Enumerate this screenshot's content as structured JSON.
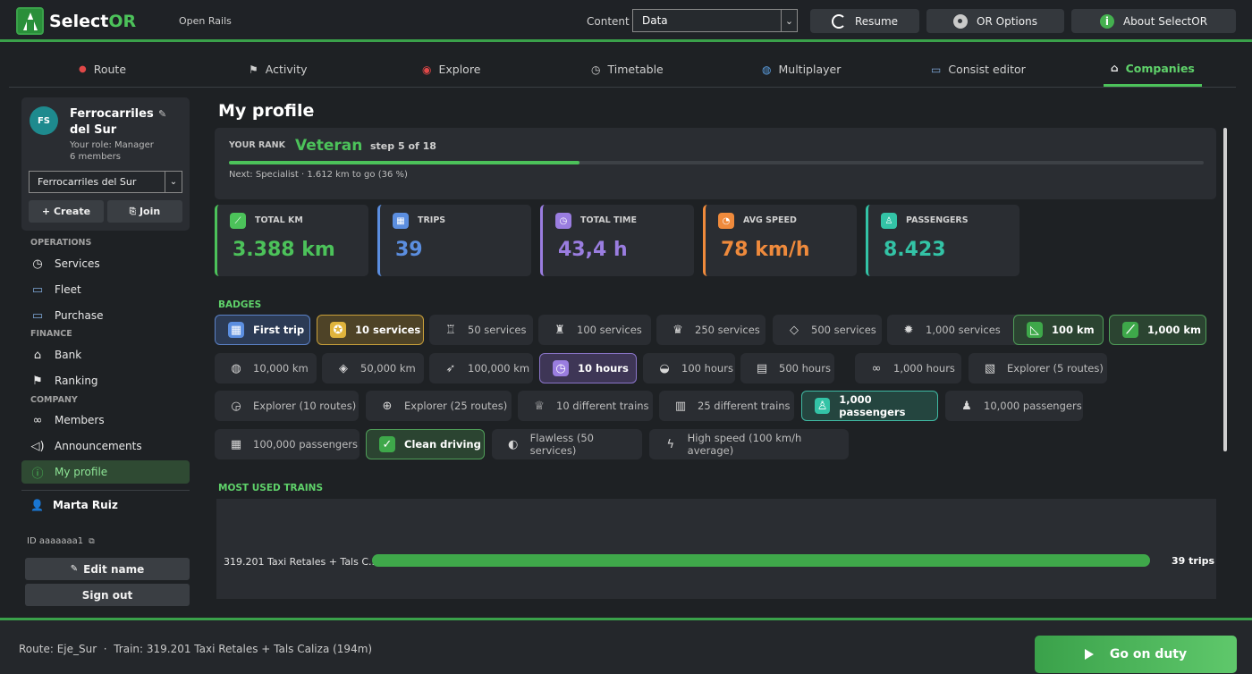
{
  "header": {
    "logo_prefix": "Select",
    "logo_suffix": "OR",
    "subtitle": "Open Rails",
    "content_label": "Content",
    "content_value": "Data",
    "resume_label": "Resume",
    "or_options_label": "OR Options",
    "about_label": "About SelectOR"
  },
  "tabs": [
    {
      "label": "Route",
      "icon": "📍"
    },
    {
      "label": "Activity",
      "icon": "🏁"
    },
    {
      "label": "Explore",
      "icon": "◉"
    },
    {
      "label": "Timetable",
      "icon": "◷"
    },
    {
      "label": "Multiplayer",
      "icon": "🌐"
    },
    {
      "label": "Consist editor",
      "icon": "🚃"
    },
    {
      "label": "Companies",
      "icon": "🏛"
    }
  ],
  "sidebar": {
    "company": {
      "initials": "FS",
      "name": "Ferrocarriles del Sur",
      "role": "Your role: Manager",
      "members": "6 members",
      "selected": "Ferrocarriles del Sur",
      "create_label": "+ Create",
      "join_label": "Join"
    },
    "sections": {
      "operations": "OPERATIONS",
      "finance": "FINANCE",
      "company": "COMPANY"
    },
    "items": {
      "services": "Services",
      "fleet": "Fleet",
      "purchase": "Purchase",
      "bank": "Bank",
      "ranking": "Ranking",
      "members": "Members",
      "announcements": "Announcements",
      "my_profile": "My profile"
    },
    "user_name": "Marta Ruiz",
    "user_id": "ID aaaaaaa1",
    "edit_name_label": "Edit name",
    "sign_out_label": "Sign out"
  },
  "main": {
    "title": "My profile",
    "rank": {
      "label": "YOUR RANK",
      "name": "Veteran",
      "step": "step 5 of 18",
      "progress": 0.36,
      "next": "Next: Specialist · 1.612 km to go (36 %)"
    },
    "stats": [
      {
        "label": "TOTAL KM",
        "value": "3.388 km",
        "color": "#4cc25a",
        "icon": "⟋"
      },
      {
        "label": "TRIPS",
        "value": "39",
        "color": "#5b8ee0",
        "icon": "▦"
      },
      {
        "label": "TOTAL TIME",
        "value": "43,4 h",
        "color": "#9a7de0",
        "icon": "◷"
      },
      {
        "label": "AVG SPEED",
        "value": "78 km/h",
        "color": "#ef8a3c",
        "icon": "◔"
      },
      {
        "label": "PASSENGERS",
        "value": "8.423",
        "color": "#33c3a6",
        "icon": "♙"
      }
    ],
    "badges_title": "BADGES",
    "badges": [
      {
        "label": "First trip",
        "icon": "▦",
        "tier": "blue"
      },
      {
        "label": "10 services",
        "icon": "✪",
        "tier": "gold"
      },
      {
        "label": "50 services",
        "icon": "♖",
        "tier": ""
      },
      {
        "label": "100 services",
        "icon": "♜",
        "tier": ""
      },
      {
        "label": "250 services",
        "icon": "♛",
        "tier": ""
      },
      {
        "label": "500 services",
        "icon": "◇",
        "tier": ""
      },
      {
        "label": "1,000 services",
        "icon": "✹",
        "tier": ""
      },
      {
        "label": "100 km",
        "icon": "◺",
        "tier": "green"
      },
      {
        "label": "1,000 km",
        "icon": "⟋",
        "tier": "green"
      },
      {
        "label": "10,000 km",
        "icon": "◍",
        "tier": ""
      },
      {
        "label": "50,000 km",
        "icon": "◈",
        "tier": ""
      },
      {
        "label": "100,000 km",
        "icon": "➶",
        "tier": ""
      },
      {
        "label": "10 hours",
        "icon": "◷",
        "tier": "purple"
      },
      {
        "label": "100 hours",
        "icon": "◒",
        "tier": ""
      },
      {
        "label": "500 hours",
        "icon": "▤",
        "tier": ""
      },
      {
        "label": "1,000 hours",
        "icon": "∞",
        "tier": ""
      },
      {
        "label": "Explorer (5 routes)",
        "icon": "▧",
        "tier": ""
      },
      {
        "label": "Explorer (10 routes)",
        "icon": "◶",
        "tier": ""
      },
      {
        "label": "Explorer (25 routes)",
        "icon": "⊕",
        "tier": ""
      },
      {
        "label": "10 different trains",
        "icon": "♕",
        "tier": ""
      },
      {
        "label": "25 different trains",
        "icon": "▥",
        "tier": ""
      },
      {
        "label": "1,000 passengers",
        "icon": "♙",
        "tier": "teal"
      },
      {
        "label": "10,000 passengers",
        "icon": "♟",
        "tier": ""
      },
      {
        "label": "100,000 passengers",
        "icon": "▦",
        "tier": ""
      },
      {
        "label": "Clean driving",
        "icon": "✓",
        "tier": "green"
      },
      {
        "label": "Flawless (50 services)",
        "icon": "◐",
        "tier": ""
      },
      {
        "label": "High speed (100 km/h average)",
        "icon": "ϟ",
        "tier": ""
      }
    ],
    "trains_title": "MOST USED TRAINS",
    "trains": [
      {
        "name": "319.201 Taxi Retales + Tals C...",
        "trips": "39 trips",
        "share": 1.0
      }
    ]
  },
  "footer": {
    "status": "Route: Eje_Sur  ·  Train: 319.201 Taxi Retales + Tals Caliza (194m)",
    "go_label": "Go on duty"
  }
}
